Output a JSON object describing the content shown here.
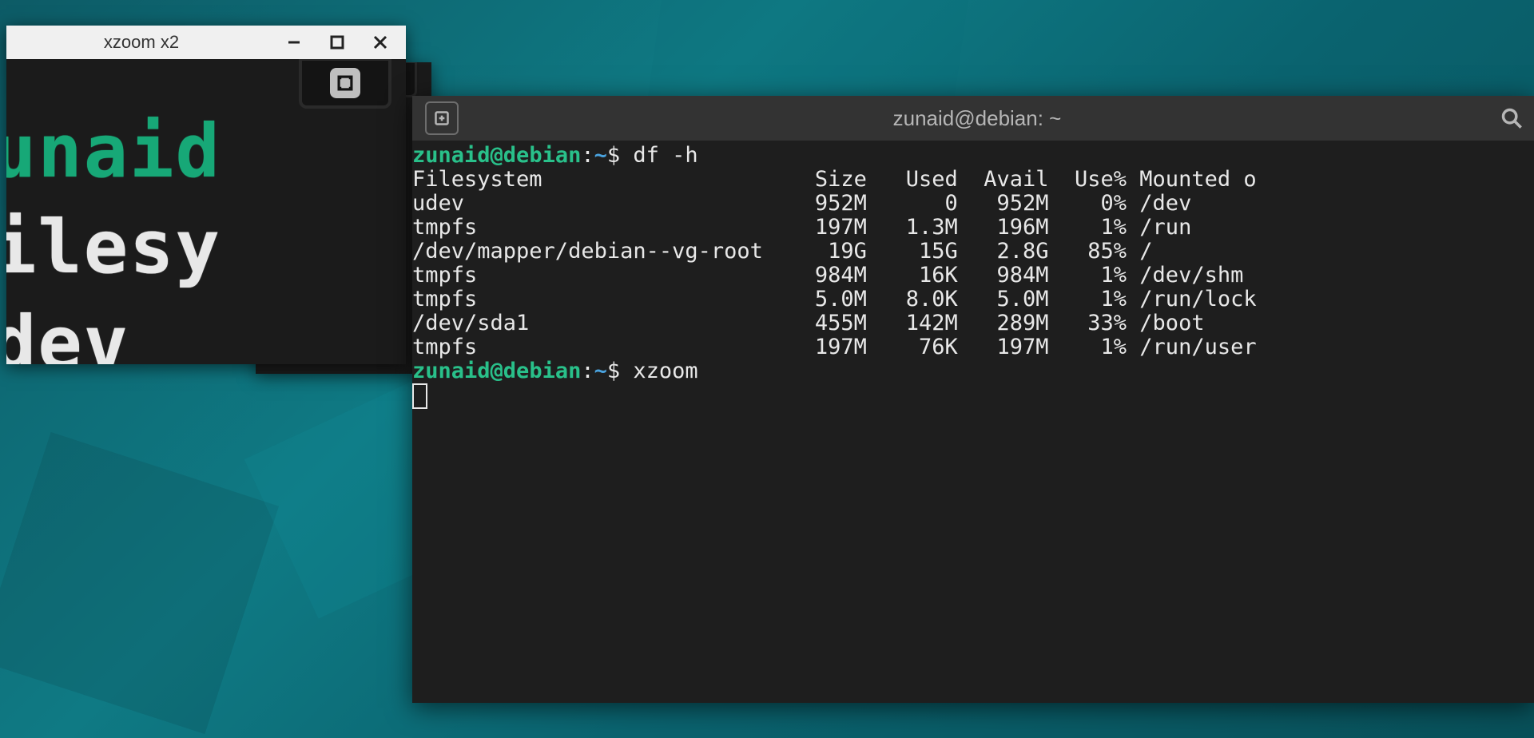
{
  "xzoom": {
    "title": "xzoom x2",
    "magnified_lines": {
      "l1": "unaid",
      "l2": "ilesy",
      "l3": "dev"
    }
  },
  "blur_layer": {
    "l1": "zunaid",
    "l2": "Filesy",
    "l3": "udev",
    "l4": "tmpfs",
    "l5": "/dev/m"
  },
  "terminal": {
    "title": "zunaid@debian: ~",
    "prompt": {
      "user": "zunaid",
      "at": "@",
      "host": "debian",
      "colon": ":",
      "path": "~",
      "dollar": "$ "
    },
    "cmd1": "df -h",
    "df_header": {
      "fs": "Filesystem",
      "size": "Size",
      "used": "Used",
      "avail": "Avail",
      "usep": "Use%",
      "mnt": "Mounted o"
    },
    "df_rows": [
      {
        "fs": "udev",
        "size": "952M",
        "used": "0",
        "avail": "952M",
        "usep": "0%",
        "mnt": "/dev"
      },
      {
        "fs": "tmpfs",
        "size": "197M",
        "used": "1.3M",
        "avail": "196M",
        "usep": "1%",
        "mnt": "/run"
      },
      {
        "fs": "/dev/mapper/debian--vg-root",
        "size": "19G",
        "used": "15G",
        "avail": "2.8G",
        "usep": "85%",
        "mnt": "/"
      },
      {
        "fs": "tmpfs",
        "size": "984M",
        "used": "16K",
        "avail": "984M",
        "usep": "1%",
        "mnt": "/dev/shm"
      },
      {
        "fs": "tmpfs",
        "size": "5.0M",
        "used": "8.0K",
        "avail": "5.0M",
        "usep": "1%",
        "mnt": "/run/lock"
      },
      {
        "fs": "/dev/sda1",
        "size": "455M",
        "used": "142M",
        "avail": "289M",
        "usep": "33%",
        "mnt": "/boot"
      },
      {
        "fs": "tmpfs",
        "size": "197M",
        "used": "76K",
        "avail": "197M",
        "usep": "1%",
        "mnt": "/run/user"
      }
    ],
    "cmd2": "xzoom"
  }
}
